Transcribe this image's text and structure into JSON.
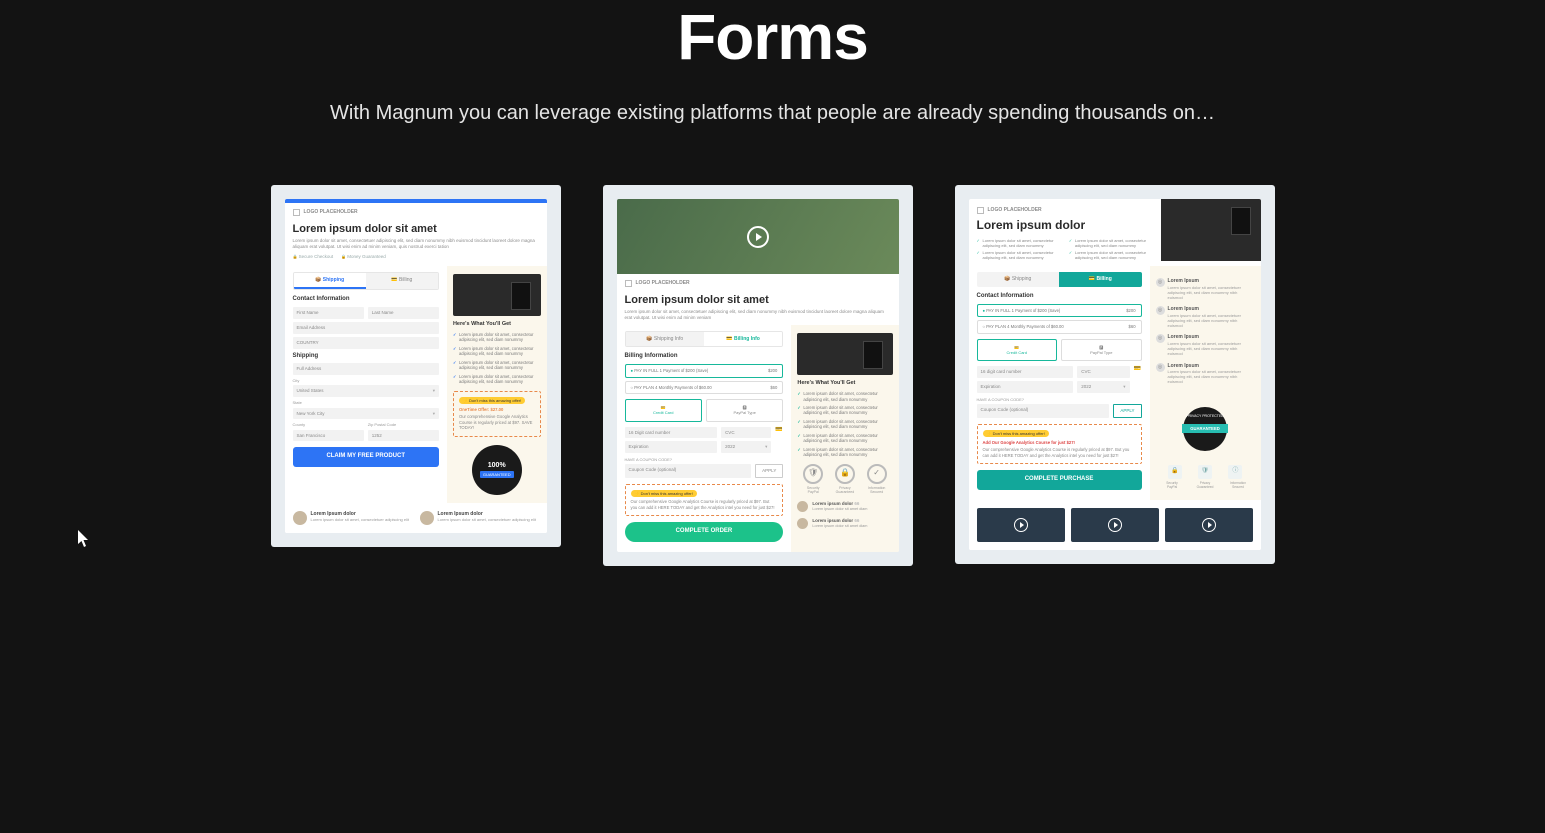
{
  "hero": {
    "title": "Forms",
    "subtitle": "With Magnum you can leverage existing platforms that people are already spending thousands on…"
  },
  "common": {
    "logo_placeholder": "LOGO PLACEHOLDER",
    "heres_what": "Here's What You'll Get",
    "check_item": "Lorem ipsum dolor sit amet, consectetur adipiscing elit, sed diam nonummy",
    "offer_pill": "Don't miss this amazing offer!",
    "apply": "APPLY"
  },
  "card1": {
    "title": "Lorem ipsum dolor sit amet",
    "sub": "Lorem ipsum dolor sit amet, consectetuer adipiscing elit, sed diam nonummy nibh euismod tincidunt laoreet dolore magna aliquam erat volutpat. Ut wisi enim ad minim veniam, quis nostrud exerci tation",
    "secure": "Secure Checkout",
    "money": "Money Guaranteed",
    "tab_shipping": "Shipping",
    "tab_billing": "Billing",
    "contact_label": "Contact Information",
    "first_name": "First Name",
    "last_name": "Last Name",
    "email": "Email Address",
    "country_val": "COUNTRY",
    "shipping_label": "Shipping",
    "full_addr": "Full Address",
    "city": "City",
    "united_states": "United States",
    "state": "State",
    "nyc": "New York City",
    "county": "County",
    "zip": "Zip Postal Code",
    "san_fran": "San Francisco",
    "zip_val": "1252",
    "cta": "CLAIM MY FREE PRODUCT",
    "offer_title": "OneTime Offer: $27.00",
    "offer_desc": "Our comprehensive Google Analytics Course is regularly priced at $97. SAVE TODAY!",
    "badge_100": "100%",
    "badge_guar": "GUARANTEED",
    "testi_name": "Lorem Ipsum dolor",
    "testi_desc": "Lorem ipsum dolor sit amet, consectetuer adipiscing elit"
  },
  "card2": {
    "title": "Lorem ipsum dolor sit amet",
    "sub": "Lorem ipsum dolor sit amet, consectetuer adipiscing elit, sed diam nonummy nibh euismod tincidunt laoreet dolore magna aliquam erat volutpat. Ut wisi enim ad minim veniam",
    "tab_shipping": "Shipping Info",
    "tab_billing": "Billing Info",
    "billing_label": "Billing Information",
    "radio1_label": "PAY IN FULL 1 Payment of $200 (Save)",
    "radio1_price": "$200",
    "radio2_label": "PAY PLAN 4 Monthly Payments of $60.00",
    "radio2_price": "$60",
    "pay_cc": "Credit Card",
    "pay_pp": "PayPal Type",
    "card_label": "16 Digit card number",
    "cvc": "CVC",
    "expiration": "Expiration",
    "exp_val": "2022",
    "coupon_label": "HAVE A COUPON CODE?",
    "coupon_ph": "Coupon Code (optional)",
    "offer_desc": "Our comprehensive Google Analytics Course is regularly priced at $97. But you can add it HERE TODAY and get the Analytics intel you need for just $27!",
    "cta": "COMPLETE ORDER",
    "trust1": "Security PayPal",
    "trust2": "Privacy Guaranteed",
    "trust3": "Information Secured",
    "testi_name": "Lorem ipsum dolor",
    "testi_q": "Lorem ipsum dolor sit amet diam"
  },
  "card3": {
    "title": "Lorem ipsum dolor",
    "tab_shipping": "Shipping",
    "tab_billing": "Billing",
    "contact_label": "Contact Information",
    "radio1_label": "PAY IN FULL 1 Payment of $200 (Save)",
    "radio1_price": "$200",
    "radio2_label": "PAY PLAN 4 Monthly Payments of $60.00",
    "radio2_price": "$60",
    "pay_cc": "Credit Card",
    "pay_pp": "PayPal Type",
    "card_label": "16 digit card number",
    "cvc": "CVC",
    "expiration": "Expiration",
    "exp_val": "2022",
    "coupon_label": "HAVE A COUPON CODE?",
    "coupon_ph": "Coupon Code (optional)",
    "offer_title": "Add Our Google Analytics Course for just $27!",
    "offer_desc": "Our comprehensive Google Analytics Course is regularly priced at $97. But you can add it HERE TODAY and get the Analytics intel you need for just $27!",
    "cta": "COMPLETE PURCHASE",
    "feat_h": "Lorem Ipsum",
    "feat_d": "Lorem ipsum dolor sit amet, consectetuer adipiscing elit, sed diam nonummy nibh euismod",
    "priv_top": "PRIVACY PROTECTED",
    "priv_rib": "GUARANTEED"
  }
}
